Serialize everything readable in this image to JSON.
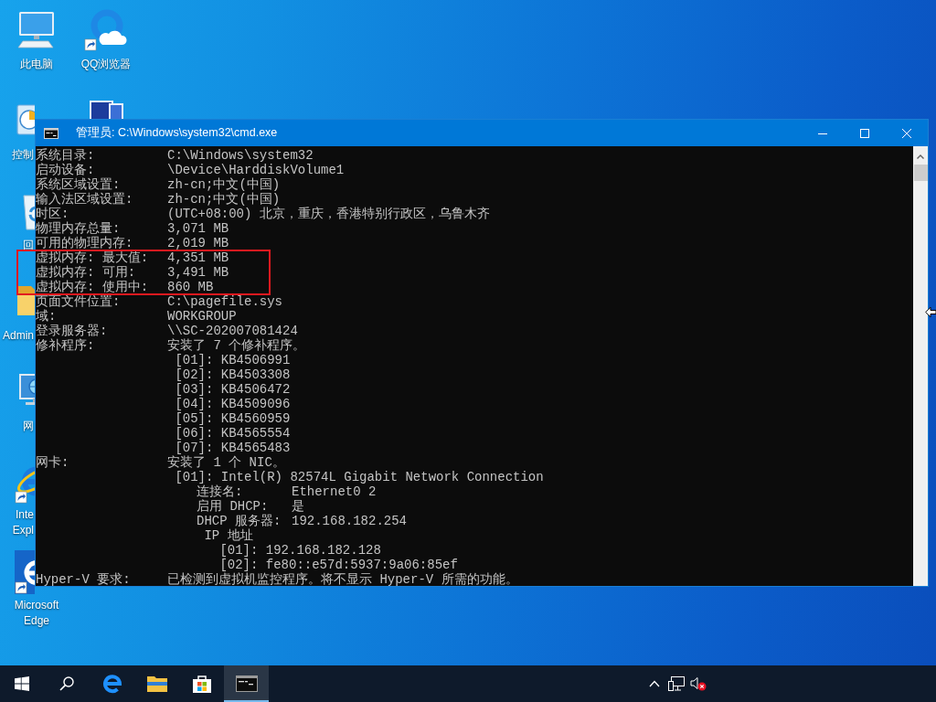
{
  "desktop": {
    "icons": [
      {
        "kind": "computer",
        "label": "此电脑",
        "shortcut": false,
        "covered": false
      },
      {
        "kind": "control-panel",
        "label": "控制",
        "covered": true,
        "shortcut": false
      },
      {
        "kind": "recycle-bin",
        "label": "回",
        "covered": true,
        "shortcut": false
      },
      {
        "kind": "folder",
        "label": "Admin",
        "covered": true,
        "shortcut": false
      },
      {
        "kind": "network",
        "label": "网",
        "covered": true,
        "shortcut": false
      },
      {
        "kind": "internet-explorer",
        "label": "Inte\nExpl",
        "covered": true,
        "shortcut": true
      },
      {
        "kind": "edge",
        "label": "Microsoft Edge",
        "shortcut": true,
        "covered": true
      },
      {
        "kind": "qq-browser",
        "label": "QQ浏览器",
        "shortcut": true,
        "covered": false
      },
      {
        "kind": "devices"
      }
    ]
  },
  "window": {
    "title": "管理员: C:\\Windows\\system32\\cmd.exe",
    "lines": [
      {
        "label": "系统目录:",
        "value": "C:\\Windows\\system32"
      },
      {
        "label": "启动设备:",
        "value": "\\Device\\HarddiskVolume1"
      },
      {
        "label": "系统区域设置:",
        "value": "zh-cn;中文(中国)"
      },
      {
        "label": "输入法区域设置:",
        "value": "zh-cn;中文(中国)"
      },
      {
        "label": "时区:",
        "value": "(UTC+08:00) 北京，重庆，香港特别行政区，乌鲁木齐"
      },
      {
        "label": "物理内存总量:",
        "value": "3,071 MB"
      },
      {
        "label": "可用的物理内存:",
        "value": "2,019 MB"
      },
      {
        "label": "虚拟内存: 最大值:",
        "value": "4,351 MB"
      },
      {
        "label": "虚拟内存: 可用:",
        "value": "3,491 MB"
      },
      {
        "label": "虚拟内存: 使用中:",
        "value": "860 MB"
      },
      {
        "label": "页面文件位置:",
        "value": "C:\\pagefile.sys"
      },
      {
        "label": "域:",
        "value": "WORKGROUP"
      },
      {
        "label": "登录服务器:",
        "value": "\\\\SC-202007081424"
      },
      {
        "label": "修补程序:",
        "value": "安装了 7 个修补程序。",
        "children": [
          {
            "value": "[01]: KB4506991"
          },
          {
            "value": "[02]: KB4503308"
          },
          {
            "value": "[03]: KB4506472"
          },
          {
            "value": "[04]: KB4509096"
          },
          {
            "value": "[05]: KB4560959"
          },
          {
            "value": "[06]: KB4565554"
          },
          {
            "value": "[07]: KB4565483"
          }
        ]
      },
      {
        "label": "网卡:",
        "value": "安装了 1 个 NIC。",
        "children": [
          {
            "value": "[01]: Intel(R) 82574L Gigabit Network Connection",
            "children": [
              {
                "label": "连接名:",
                "value": "Ethernet0 2"
              },
              {
                "label": "启用 DHCP:",
                "value": "是"
              },
              {
                "label": "DHCP 服务器:",
                "value": "192.168.182.254"
              },
              {
                "value": "IP 地址",
                "children": [
                  {
                    "value": "[01]: 192.168.182.128"
                  },
                  {
                    "value": "[02]: fe80::e57d:5937:9a06:85ef"
                  }
                ]
              }
            ]
          }
        ]
      },
      {
        "label": "Hyper-V 要求:",
        "value": "已检测到虚拟机监控程序。将不显示 Hyper-V 所需的功能。"
      }
    ]
  },
  "annotations": [
    {
      "kind": "rectangle"
    }
  ],
  "taskbar": {
    "apps": [
      {
        "kind": "edge",
        "selected": false
      },
      {
        "kind": "explorer",
        "selected": false
      },
      {
        "kind": "store",
        "selected": false
      },
      {
        "kind": "terminal",
        "selected": true
      }
    ],
    "tray": [
      {
        "kind": "chevron"
      },
      {
        "kind": "network"
      },
      {
        "kind": "volume-muted"
      }
    ]
  }
}
